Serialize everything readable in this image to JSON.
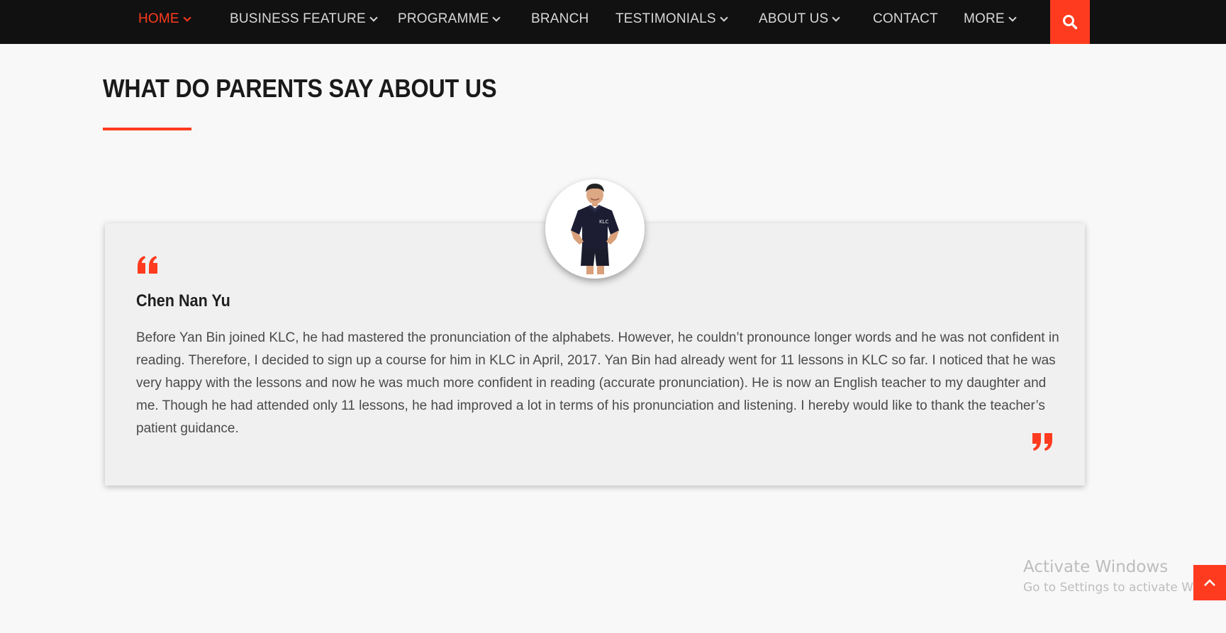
{
  "nav": {
    "items": [
      {
        "label": "HOME",
        "has_dropdown": true,
        "active": true
      },
      {
        "label": "BUSINESS FEATURE",
        "has_dropdown": true
      },
      {
        "label": "PROGRAMME",
        "has_dropdown": true
      },
      {
        "label": "BRANCH",
        "has_dropdown": false
      },
      {
        "label": "TESTIMONIALS",
        "has_dropdown": true
      },
      {
        "label": "ABOUT US",
        "has_dropdown": true
      },
      {
        "label": "CONTACT",
        "has_dropdown": false
      },
      {
        "label": "MORE",
        "has_dropdown": true
      }
    ],
    "search_icon": "search-icon"
  },
  "section": {
    "title": "WHAT DO PARENTS SAY ABOUT US"
  },
  "testimonial": {
    "name": "Chen Nan Yu",
    "text": "Before Yan Bin joined KLC, he had mastered the pronunciation of the alphabets. However, he couldn’t pronounce longer words and he was not confident in reading. Therefore, I decided to sign up a course for him in KLC in April, 2017. Yan Bin had already went for 11 lessons in KLC so far. I noticed that he was very happy with the lessons and now he was much more confident in reading (accurate pronunciation). He is now an English teacher to my daughter and me. Though he had attended only 11 lessons, he had improved a lot in terms of his pronunciation and listening. I hereby would like to thank the teacher’s patient guidance.",
    "avatar_logo": "KLC"
  },
  "watermark": {
    "line1": "Activate Windows",
    "line2": "Go to Settings to activate Windows."
  },
  "colors": {
    "accent": "#ff3b1f",
    "nav_bg": "#111111",
    "page_bg": "#f8f8f8",
    "card_bg": "#f0f0f0"
  }
}
